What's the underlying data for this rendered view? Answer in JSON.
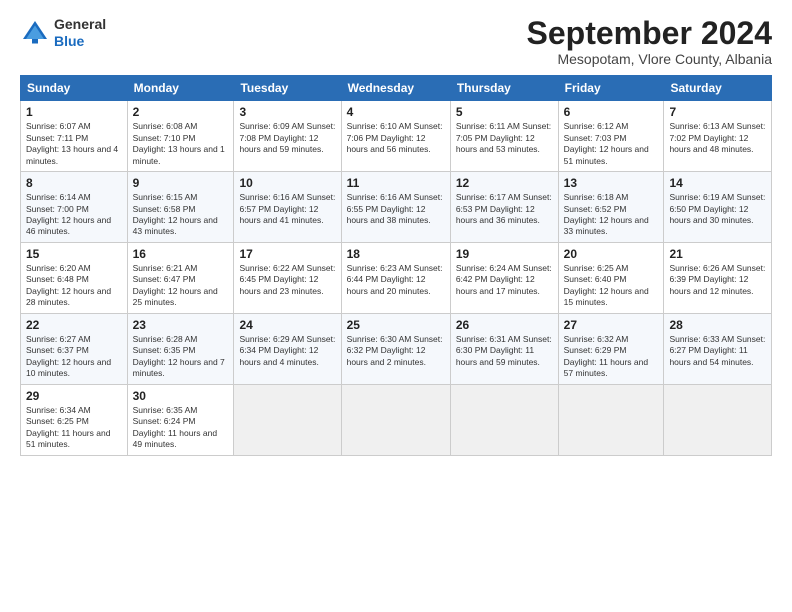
{
  "header": {
    "logo_general": "General",
    "logo_blue": "Blue",
    "month_year": "September 2024",
    "location": "Mesopotam, Vlore County, Albania"
  },
  "weekdays": [
    "Sunday",
    "Monday",
    "Tuesday",
    "Wednesday",
    "Thursday",
    "Friday",
    "Saturday"
  ],
  "weeks": [
    [
      {
        "day": "1",
        "info": "Sunrise: 6:07 AM\nSunset: 7:11 PM\nDaylight: 13 hours\nand 4 minutes."
      },
      {
        "day": "2",
        "info": "Sunrise: 6:08 AM\nSunset: 7:10 PM\nDaylight: 13 hours\nand 1 minute."
      },
      {
        "day": "3",
        "info": "Sunrise: 6:09 AM\nSunset: 7:08 PM\nDaylight: 12 hours\nand 59 minutes."
      },
      {
        "day": "4",
        "info": "Sunrise: 6:10 AM\nSunset: 7:06 PM\nDaylight: 12 hours\nand 56 minutes."
      },
      {
        "day": "5",
        "info": "Sunrise: 6:11 AM\nSunset: 7:05 PM\nDaylight: 12 hours\nand 53 minutes."
      },
      {
        "day": "6",
        "info": "Sunrise: 6:12 AM\nSunset: 7:03 PM\nDaylight: 12 hours\nand 51 minutes."
      },
      {
        "day": "7",
        "info": "Sunrise: 6:13 AM\nSunset: 7:02 PM\nDaylight: 12 hours\nand 48 minutes."
      }
    ],
    [
      {
        "day": "8",
        "info": "Sunrise: 6:14 AM\nSunset: 7:00 PM\nDaylight: 12 hours\nand 46 minutes."
      },
      {
        "day": "9",
        "info": "Sunrise: 6:15 AM\nSunset: 6:58 PM\nDaylight: 12 hours\nand 43 minutes."
      },
      {
        "day": "10",
        "info": "Sunrise: 6:16 AM\nSunset: 6:57 PM\nDaylight: 12 hours\nand 41 minutes."
      },
      {
        "day": "11",
        "info": "Sunrise: 6:16 AM\nSunset: 6:55 PM\nDaylight: 12 hours\nand 38 minutes."
      },
      {
        "day": "12",
        "info": "Sunrise: 6:17 AM\nSunset: 6:53 PM\nDaylight: 12 hours\nand 36 minutes."
      },
      {
        "day": "13",
        "info": "Sunrise: 6:18 AM\nSunset: 6:52 PM\nDaylight: 12 hours\nand 33 minutes."
      },
      {
        "day": "14",
        "info": "Sunrise: 6:19 AM\nSunset: 6:50 PM\nDaylight: 12 hours\nand 30 minutes."
      }
    ],
    [
      {
        "day": "15",
        "info": "Sunrise: 6:20 AM\nSunset: 6:48 PM\nDaylight: 12 hours\nand 28 minutes."
      },
      {
        "day": "16",
        "info": "Sunrise: 6:21 AM\nSunset: 6:47 PM\nDaylight: 12 hours\nand 25 minutes."
      },
      {
        "day": "17",
        "info": "Sunrise: 6:22 AM\nSunset: 6:45 PM\nDaylight: 12 hours\nand 23 minutes."
      },
      {
        "day": "18",
        "info": "Sunrise: 6:23 AM\nSunset: 6:44 PM\nDaylight: 12 hours\nand 20 minutes."
      },
      {
        "day": "19",
        "info": "Sunrise: 6:24 AM\nSunset: 6:42 PM\nDaylight: 12 hours\nand 17 minutes."
      },
      {
        "day": "20",
        "info": "Sunrise: 6:25 AM\nSunset: 6:40 PM\nDaylight: 12 hours\nand 15 minutes."
      },
      {
        "day": "21",
        "info": "Sunrise: 6:26 AM\nSunset: 6:39 PM\nDaylight: 12 hours\nand 12 minutes."
      }
    ],
    [
      {
        "day": "22",
        "info": "Sunrise: 6:27 AM\nSunset: 6:37 PM\nDaylight: 12 hours\nand 10 minutes."
      },
      {
        "day": "23",
        "info": "Sunrise: 6:28 AM\nSunset: 6:35 PM\nDaylight: 12 hours\nand 7 minutes."
      },
      {
        "day": "24",
        "info": "Sunrise: 6:29 AM\nSunset: 6:34 PM\nDaylight: 12 hours\nand 4 minutes."
      },
      {
        "day": "25",
        "info": "Sunrise: 6:30 AM\nSunset: 6:32 PM\nDaylight: 12 hours\nand 2 minutes."
      },
      {
        "day": "26",
        "info": "Sunrise: 6:31 AM\nSunset: 6:30 PM\nDaylight: 11 hours\nand 59 minutes."
      },
      {
        "day": "27",
        "info": "Sunrise: 6:32 AM\nSunset: 6:29 PM\nDaylight: 11 hours\nand 57 minutes."
      },
      {
        "day": "28",
        "info": "Sunrise: 6:33 AM\nSunset: 6:27 PM\nDaylight: 11 hours\nand 54 minutes."
      }
    ],
    [
      {
        "day": "29",
        "info": "Sunrise: 6:34 AM\nSunset: 6:25 PM\nDaylight: 11 hours\nand 51 minutes."
      },
      {
        "day": "30",
        "info": "Sunrise: 6:35 AM\nSunset: 6:24 PM\nDaylight: 11 hours\nand 49 minutes."
      },
      {
        "day": "",
        "info": ""
      },
      {
        "day": "",
        "info": ""
      },
      {
        "day": "",
        "info": ""
      },
      {
        "day": "",
        "info": ""
      },
      {
        "day": "",
        "info": ""
      }
    ]
  ]
}
